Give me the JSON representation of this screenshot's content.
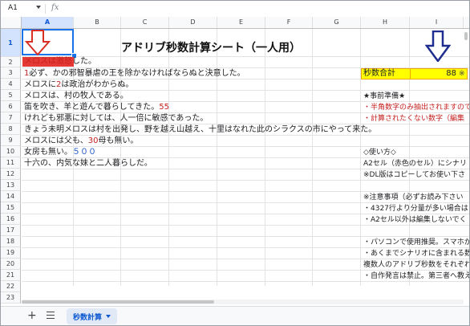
{
  "formula_bar": {
    "cell_ref": "A1",
    "fx_symbol": "fx"
  },
  "columns": [
    "",
    "A",
    "B",
    "C",
    "D",
    "E",
    "F",
    "G",
    "H",
    "I"
  ],
  "rows": [
    "1",
    "2",
    "3",
    "4",
    "5",
    "6",
    "7",
    "8",
    "9",
    "10",
    "11",
    "12",
    "13",
    "14",
    "15",
    "16",
    "17",
    "18",
    "19",
    "20",
    "21",
    "22",
    "23"
  ],
  "selected_cell": "A1",
  "title": "アドリブ秒数計算シート（一人用）",
  "text_rows": {
    "r2": {
      "highlight": "メロスは激怒",
      "rest": "した。"
    },
    "r3": {
      "num": "1",
      "text": "必ず、かの邪智暴虐の王を除かなければならぬと決意した。"
    },
    "r4": {
      "pre": "メロスに",
      "num": "2",
      "post": "は政治がわからぬ。"
    },
    "r5": "メロスは、村の牧人である。",
    "r6": {
      "pre": "笛を吹き、羊と遊んで暮らしてきた。",
      "num": "55"
    },
    "r7": "けれども邪悪に対しては、人一倍に敏感であった。",
    "r8": "きょう未明メロスは村を出発し、野を越え山越え、十里はなれた此のシラクスの市にやって来た。",
    "r9": {
      "pre": "メロスには父も、",
      "num": "30",
      "post": "母も無い。"
    },
    "r10": {
      "pre": "女房も無い。",
      "num": "５００"
    },
    "r11": "十六の、内気な妹と二人暮らしだ。"
  },
  "side_panel": {
    "total_label": "秒数合計",
    "total_value": "88",
    "overflow_note": "※",
    "prep_heading": "★事前準備★",
    "prep_item1": "・半角数字のみ抽出されますので",
    "prep_item2": "・計算されたくない数字（編集",
    "usage_heading": "◇使い方◇",
    "usage_item1": "A2セル（赤色のセル）にシナリ",
    "usage_item2": "※DL版はコピーしてお使い下さ",
    "notes_heading": "※注意事項（必ずお読み下さい",
    "note1": "・4327行より分量が多い場合は",
    "note2": "・A2セル以外は編集しないでく",
    "note3": "・パソコンで使用推奨。スマホから",
    "note4": "・あくまでシナリオに含まれる数字",
    "note5": "複数人のアドリブ秒数をそれぞれ",
    "note6": "・自作発言は禁止。第三者へ教え"
  },
  "sheet_tabs": {
    "add_symbol": "+",
    "active_tab": "秒数計算"
  },
  "colors": {
    "accent_blue": "#1a73e8",
    "red_text": "#c5221f",
    "blue_text": "#1a53c4",
    "red_fill": "#e53935",
    "yellow_fill": "#ffff00",
    "arrow_red": "#d93025",
    "arrow_navy": "#1f2d8f"
  }
}
